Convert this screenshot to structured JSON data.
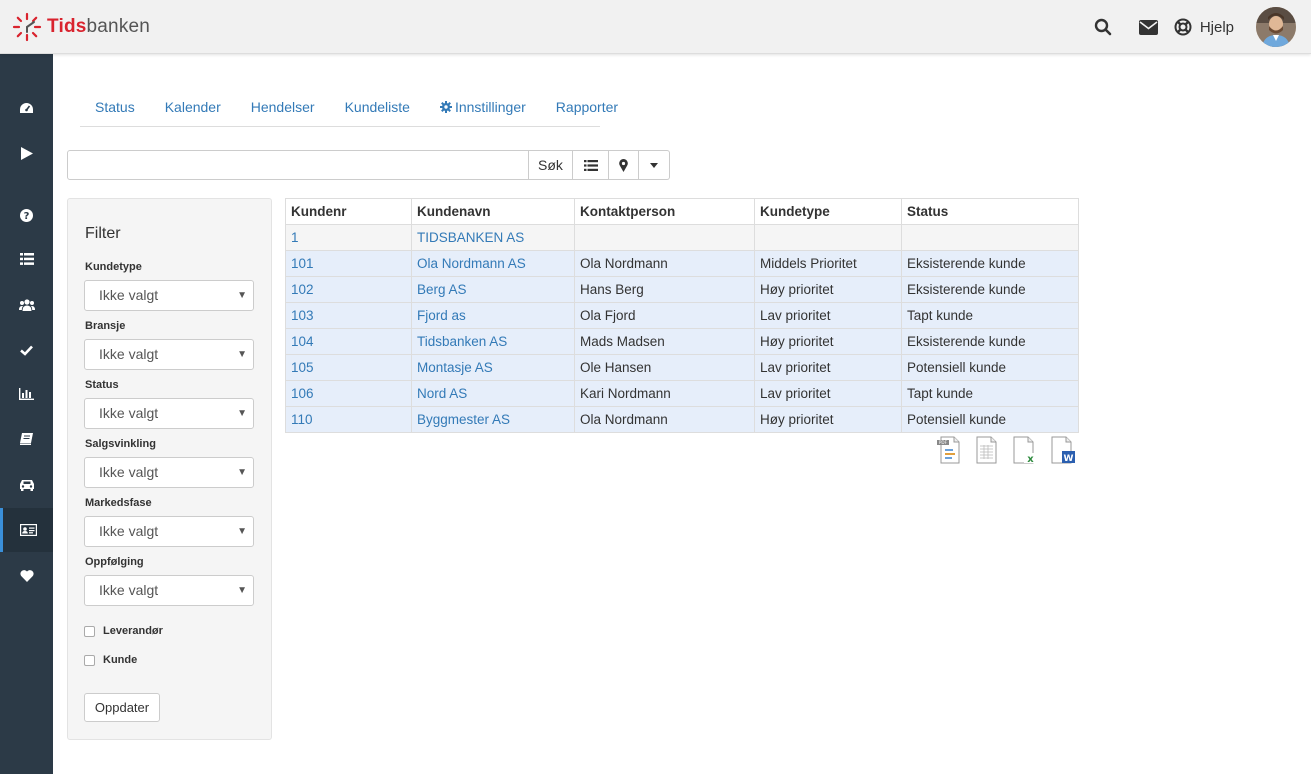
{
  "brand": {
    "logo_red": "Tids",
    "logo_grey": "banken"
  },
  "header": {
    "help_label": "Hjelp",
    "icons": [
      "search-icon",
      "envelope-icon",
      "life-ring-icon",
      "user-avatar"
    ]
  },
  "sidebar": {
    "items": [
      {
        "icon": "dashboard-icon",
        "active": false
      },
      {
        "icon": "play-icon",
        "active": false
      },
      {
        "icon": "question-circle-icon",
        "active": false
      },
      {
        "icon": "list-icon",
        "active": false
      },
      {
        "icon": "users-icon",
        "active": false
      },
      {
        "icon": "check-icon",
        "active": false
      },
      {
        "icon": "bar-chart-icon",
        "active": false
      },
      {
        "icon": "book-icon",
        "active": false
      },
      {
        "icon": "car-icon",
        "active": false
      },
      {
        "icon": "id-card-icon",
        "active": true
      },
      {
        "icon": "heart-icon",
        "active": false
      }
    ]
  },
  "tabs": [
    {
      "label": "Status"
    },
    {
      "label": "Kalender"
    },
    {
      "label": "Hendelser"
    },
    {
      "label": "Kundeliste"
    },
    {
      "label": "Innstillinger",
      "icon": "gear-icon"
    },
    {
      "label": "Rapporter"
    }
  ],
  "search": {
    "value": "",
    "placeholder": "",
    "button_label": "Søk"
  },
  "filter": {
    "title": "Filter",
    "fields": [
      {
        "label": "Kundetype",
        "value": "Ikke valgt"
      },
      {
        "label": "Bransje",
        "value": "Ikke valgt"
      },
      {
        "label": "Status",
        "value": "Ikke valgt"
      },
      {
        "label": "Salgsvinkling",
        "value": "Ikke valgt"
      },
      {
        "label": "Markedsfase",
        "value": "Ikke valgt"
      },
      {
        "label": "Oppfølging",
        "value": "Ikke valgt"
      }
    ],
    "checkboxes": [
      {
        "label": "Leverandør",
        "checked": false
      },
      {
        "label": "Kunde",
        "checked": false
      }
    ],
    "update_label": "Oppdater"
  },
  "table": {
    "columns": [
      "Kundenr",
      "Kundenavn",
      "Kontaktperson",
      "Kundetype",
      "Status"
    ],
    "rows": [
      [
        "1",
        "TIDSBANKEN AS",
        "",
        "",
        ""
      ],
      [
        "101",
        "Ola Nordmann AS",
        "Ola Nordmann",
        "Middels Prioritet",
        "Eksisterende kunde"
      ],
      [
        "102",
        "Berg AS",
        "Hans Berg",
        "Høy prioritet",
        "Eksisterende kunde"
      ],
      [
        "103",
        "Fjord as",
        "Ola Fjord",
        "Lav prioritet",
        "Tapt kunde"
      ],
      [
        "104",
        "Tidsbanken AS",
        "Mads Madsen",
        "Høy prioritet",
        "Eksisterende kunde"
      ],
      [
        "105",
        "Montasje AS",
        "Ole Hansen",
        "Lav prioritet",
        "Potensiell kunde"
      ],
      [
        "106",
        "Nord AS",
        "Kari Nordmann",
        "Lav prioritet",
        "Tapt kunde"
      ],
      [
        "110",
        "Byggmester AS",
        "Ola Nordmann",
        "Høy prioritet",
        "Potensiell kunde"
      ]
    ]
  },
  "exports": [
    "pdf-export-icon",
    "csv-export-icon",
    "excel-export-icon",
    "word-export-icon"
  ],
  "colors": {
    "link": "#337ab7",
    "sidebar": "#2c3a47",
    "sidebar_active": "#3a8fd9",
    "brand_red": "#d9232e",
    "row_selected": "#e6eefa"
  }
}
